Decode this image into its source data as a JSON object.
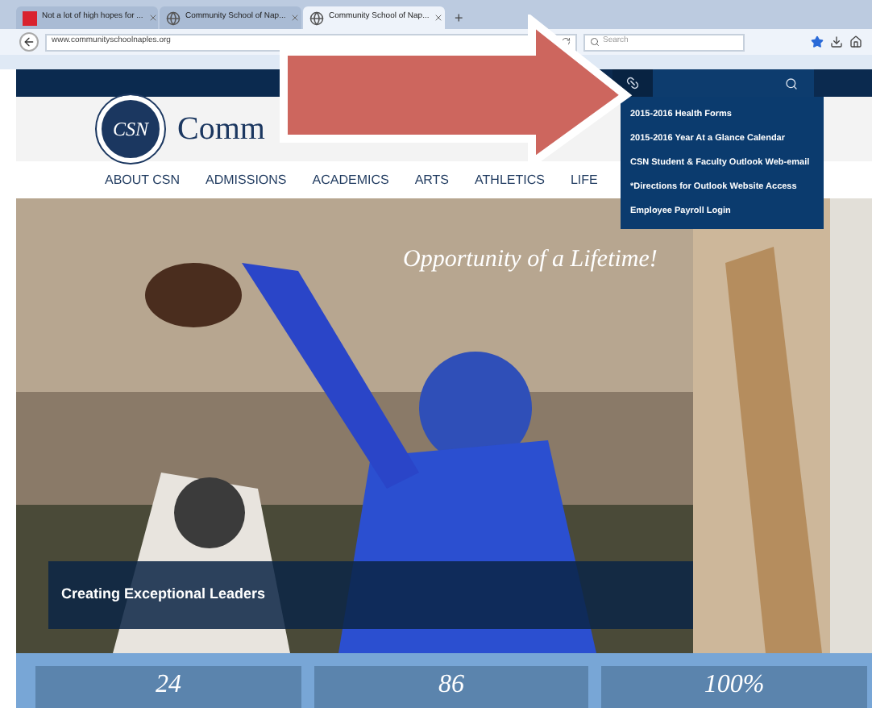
{
  "browser": {
    "tabs": [
      {
        "title": "Not a lot of high hopes for ...",
        "kind": "news",
        "selected": false
      },
      {
        "title": "Community School of Nap...",
        "kind": "site",
        "selected": false
      },
      {
        "title": "Community School of Nap...",
        "kind": "site",
        "selected": true
      }
    ],
    "new_tab": "+",
    "address": "www.communityschoolnaples.org",
    "search": {
      "placeholder": "Search"
    }
  },
  "site": {
    "logo": "CSN",
    "title": "Comm",
    "nav": [
      "ABOUT CSN",
      "ADMISSIONS",
      "ACADEMICS",
      "ARTS",
      "ATHLETICS",
      "LIFE"
    ],
    "links_open": true,
    "links_menu": [
      "2015-2016 Health Forms",
      "2015-2016 Year At a Glance Calendar",
      "CSN Student & Faculty Outlook Web-email",
      "*Directions for Outlook Website Access",
      "Employee Payroll Login"
    ],
    "hero": {
      "headline": "Opportunity of a Lifetime!",
      "caption": "Creating Exceptional Leaders"
    },
    "stats": [
      "24",
      "86",
      "100%"
    ]
  }
}
